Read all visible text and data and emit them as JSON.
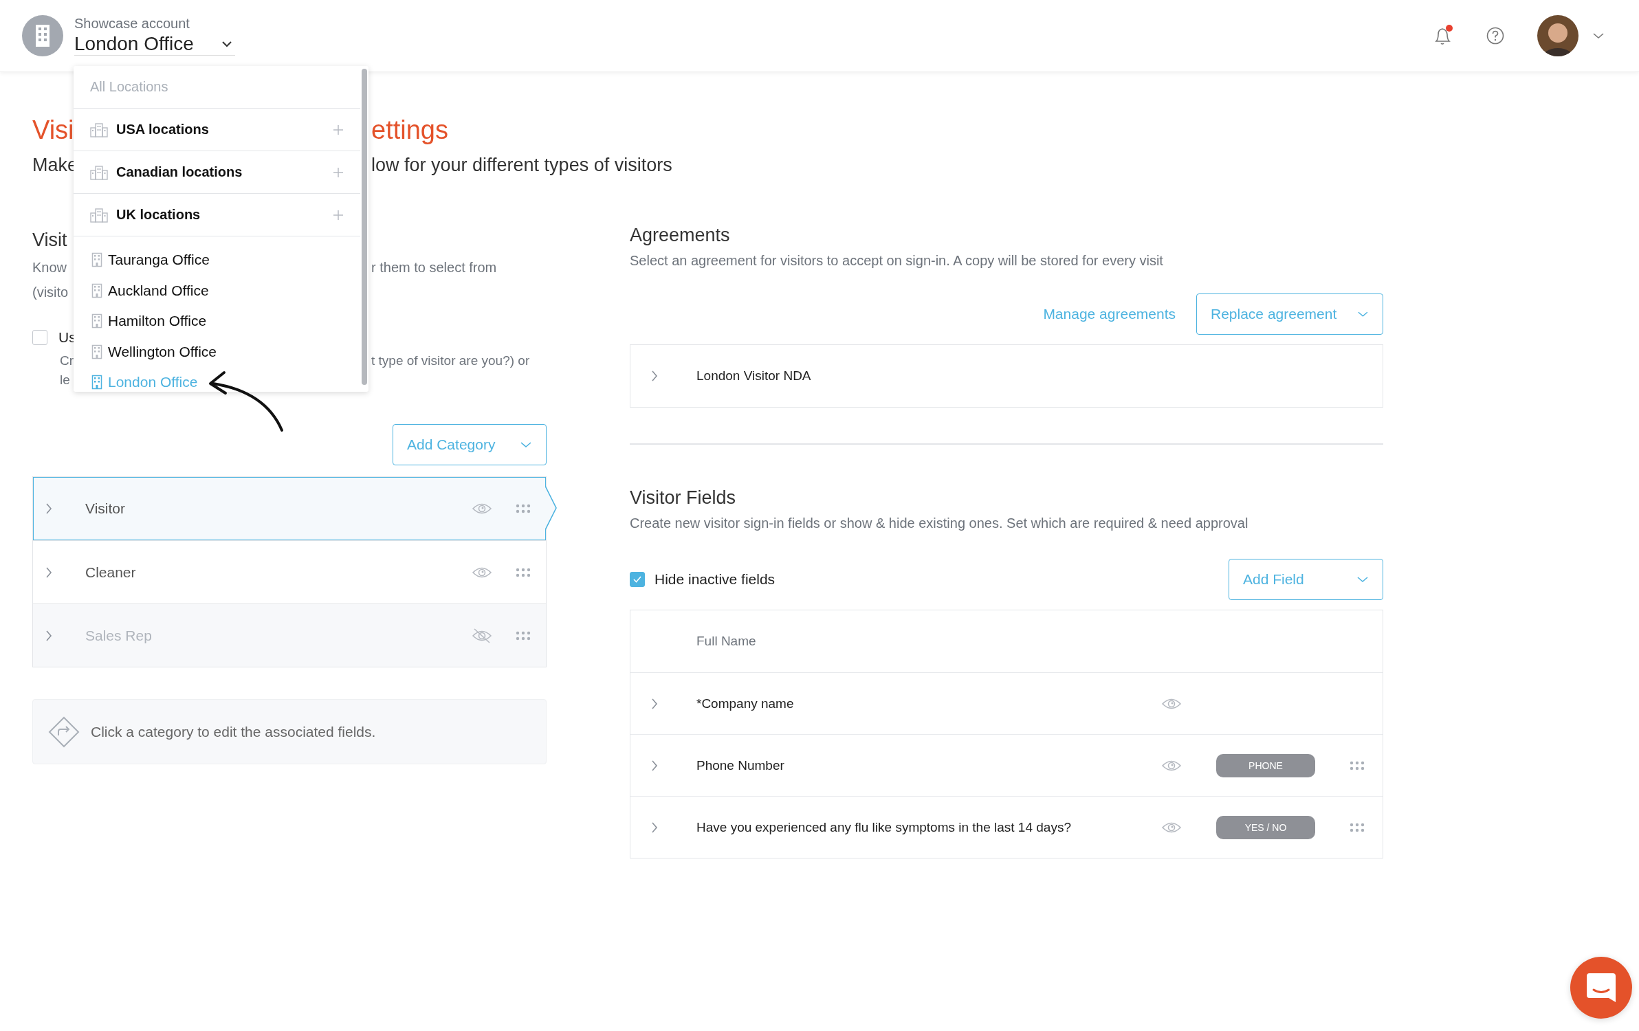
{
  "header": {
    "account_label": "Showcase account",
    "location": "London Office",
    "notification_badge": true
  },
  "location_menu": {
    "header": "All Locations",
    "groups": [
      {
        "label": "USA locations"
      },
      {
        "label": "Canadian locations"
      },
      {
        "label": "UK locations"
      }
    ],
    "offices": [
      {
        "label": "Tauranga Office",
        "selected": false
      },
      {
        "label": "Auckland Office",
        "selected": false
      },
      {
        "label": "Hamilton Office",
        "selected": false
      },
      {
        "label": "Wellington Office",
        "selected": false
      },
      {
        "label": "London Office",
        "selected": true
      }
    ]
  },
  "page": {
    "title_left": "Visi",
    "title_right": "ettings",
    "subtitle_left": "Make",
    "subtitle_right": "low for your different types of visitors"
  },
  "visitor_types": {
    "heading": "Visit",
    "desc_line_1_left": "Know",
    "desc_line_1_right": "r them to select from",
    "desc_line_2_left": "(visito",
    "option": {
      "label": "Us",
      "checked": false
    },
    "option_desc_1_left": "Cr",
    "option_desc_1_right": "t type of visitor are you?) or",
    "option_desc_2_left": "le",
    "add_button": "Add Category",
    "categories": [
      {
        "name": "Visitor",
        "selected": true,
        "visible": true
      },
      {
        "name": "Cleaner",
        "selected": false,
        "visible": true
      },
      {
        "name": "Sales Rep",
        "selected": false,
        "visible": false
      }
    ],
    "hint": "Click a category to edit the associated fields."
  },
  "agreements": {
    "heading": "Agreements",
    "description": "Select an agreement for visitors to accept on sign-in. A copy will be stored for every visit",
    "manage_link": "Manage agreements",
    "replace_button": "Replace agreement",
    "items": [
      {
        "name": "London Visitor NDA"
      }
    ]
  },
  "visitor_fields": {
    "heading": "Visitor Fields",
    "description": "Create new visitor sign-in fields or show & hide existing ones. Set which are required & need approval",
    "hide_inactive": {
      "label": "Hide inactive fields",
      "checked": true
    },
    "add_button": "Add Field",
    "fields": [
      {
        "kind": "fixed",
        "name": "Full Name"
      },
      {
        "kind": "field",
        "name": "*Company name"
      },
      {
        "kind": "field",
        "name": "Phone Number",
        "badge": "PHONE"
      },
      {
        "kind": "field",
        "name": "Have you experienced any flu like symptoms in the last 14 days?",
        "badge": "YES / NO"
      }
    ]
  }
}
